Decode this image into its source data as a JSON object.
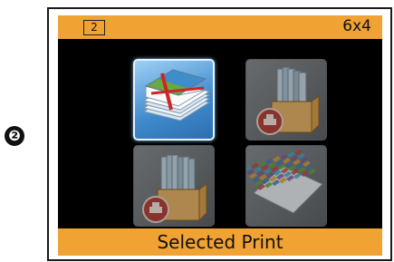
{
  "step_marker": "❷",
  "header": {
    "copies": "2",
    "paper_size": "6x4"
  },
  "footer": {
    "mode_label": "Selected Print"
  },
  "tiles": [
    {
      "name": "print-all-photos",
      "selected": true,
      "icon": "photo-stack-icon"
    },
    {
      "name": "print-from-box",
      "selected": false,
      "icon": "photo-box-printer-icon"
    },
    {
      "name": "print-from-box-2",
      "selected": false,
      "icon": "photo-box-printer-icon"
    },
    {
      "name": "index-print",
      "selected": false,
      "icon": "index-sheet-icon"
    }
  ],
  "colors": {
    "bar": "#f0a233",
    "screen": "#000000",
    "selected_tile": "#3e89cc"
  }
}
